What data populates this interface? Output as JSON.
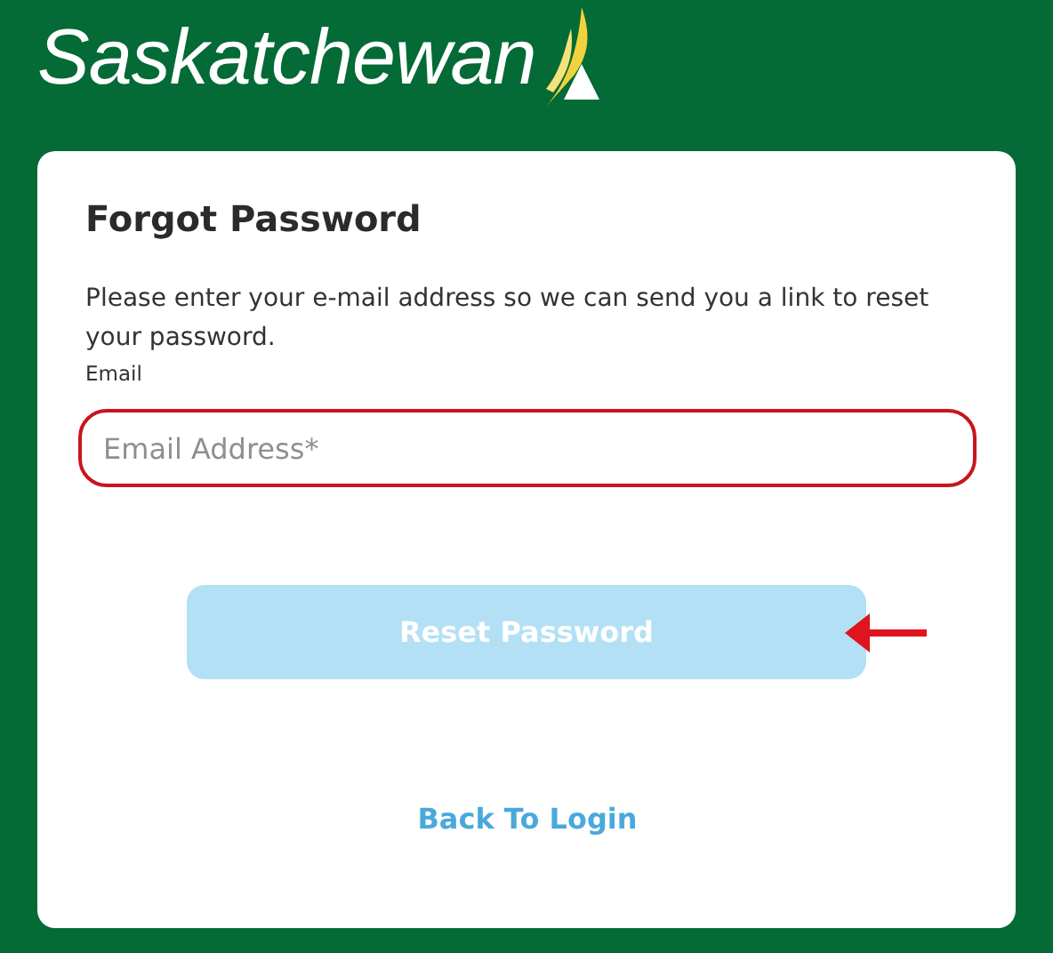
{
  "logo": {
    "text": "Saskatchewan"
  },
  "form": {
    "title": "Forgot Password",
    "instructions": "Please enter your e-mail address so we can send you a link to reset your password.",
    "email_label": "Email",
    "email_field": {
      "placeholder": "Email Address*",
      "invalid": true
    },
    "submit": {
      "label": "Reset Password",
      "disabled": true
    },
    "back_link": "Back To Login"
  },
  "annotation": {
    "kind": "arrow"
  }
}
